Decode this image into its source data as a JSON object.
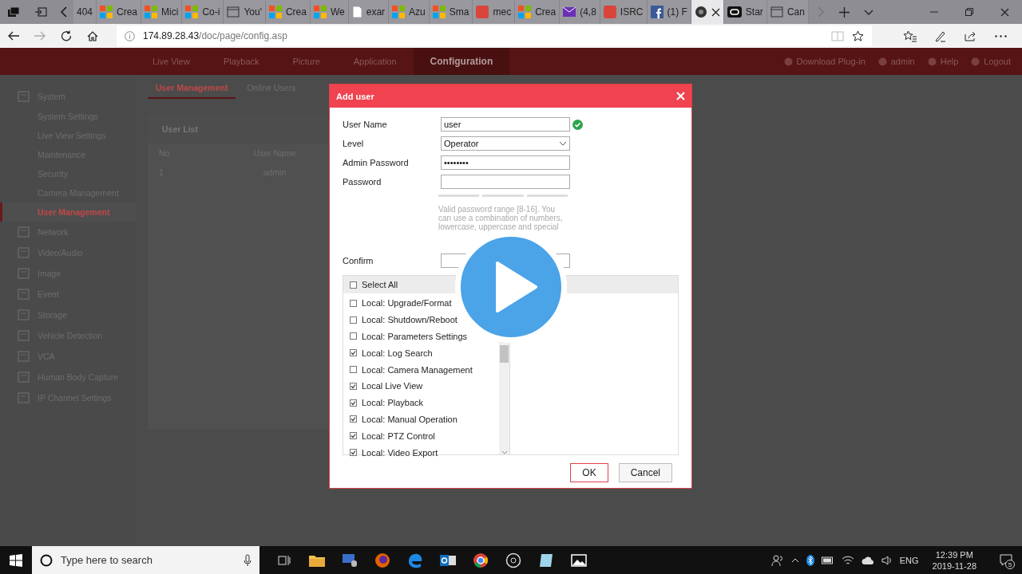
{
  "browser": {
    "tabs": [
      {
        "kind": "none",
        "title": "404",
        "selected": false
      },
      {
        "kind": "tiles",
        "title": "Crea",
        "selected": false
      },
      {
        "kind": "tiles",
        "title": "Mici",
        "selected": false
      },
      {
        "kind": "tiles",
        "title": "Co-i",
        "selected": false
      },
      {
        "kind": "window",
        "title": "You'",
        "selected": false
      },
      {
        "kind": "tiles",
        "title": "Crea",
        "selected": false
      },
      {
        "kind": "tiles",
        "title": "We",
        "selected": false
      },
      {
        "kind": "page",
        "title": "exar",
        "selected": false
      },
      {
        "kind": "tiles",
        "title": "Azu",
        "selected": false
      },
      {
        "kind": "tiles",
        "title": "Sma",
        "selected": false
      },
      {
        "kind": "badge",
        "title": "mec",
        "selected": false
      },
      {
        "kind": "tiles",
        "title": "Crea",
        "selected": false
      },
      {
        "kind": "mail",
        "title": "(4,8",
        "selected": false
      },
      {
        "kind": "badge",
        "title": "ISRC",
        "selected": false
      },
      {
        "kind": "facebook",
        "title": "(1) F",
        "selected": false
      },
      {
        "kind": "camera",
        "selected": true
      },
      {
        "kind": "oval",
        "title": "Star",
        "selected": false
      },
      {
        "kind": "window",
        "title": "Can",
        "selected": false
      }
    ],
    "address_host": "174.89.28.43",
    "address_path": "/doc/page/config.asp"
  },
  "header": {
    "nav": [
      {
        "label": "Live View",
        "selected": false
      },
      {
        "label": "Playback",
        "selected": false
      },
      {
        "label": "Picture",
        "selected": false
      },
      {
        "label": "Application",
        "selected": false
      },
      {
        "label": "Configuration",
        "selected": true
      }
    ],
    "links": [
      "Download Plug-in",
      "admin",
      "Help",
      "Logout"
    ]
  },
  "sidebar": {
    "items": [
      {
        "label": "System",
        "children": [
          {
            "label": "System Settings",
            "selected": false
          },
          {
            "label": "Live View Settings",
            "selected": false
          },
          {
            "label": "Maintenance",
            "selected": false
          },
          {
            "label": "Security",
            "selected": false
          },
          {
            "label": "Camera Management",
            "selected": false
          },
          {
            "label": "User Management",
            "selected": true
          }
        ]
      },
      {
        "label": "Network"
      },
      {
        "label": "Video/Audio"
      },
      {
        "label": "Image"
      },
      {
        "label": "Event"
      },
      {
        "label": "Storage"
      },
      {
        "label": "Vehicle Detection"
      },
      {
        "label": "VCA"
      },
      {
        "label": "Human Body Capture"
      },
      {
        "label": "IP Channel Settings"
      }
    ]
  },
  "content": {
    "tabs": [
      {
        "label": "User Management",
        "selected": true
      },
      {
        "label": "Online Users",
        "selected": false
      }
    ],
    "user_list": {
      "title": "User List",
      "columns": [
        "No",
        "User Name"
      ],
      "rows": [
        [
          "1",
          "admin"
        ]
      ]
    }
  },
  "dialog": {
    "title": "Add user",
    "fields": [
      {
        "kind": "text",
        "label": "User Name",
        "value": "user",
        "valid": true
      },
      {
        "kind": "select",
        "label": "Level",
        "value": "Operator"
      },
      {
        "kind": "password",
        "label": "Admin Password",
        "value": "••••••••"
      },
      {
        "kind": "password",
        "label": "Password"
      }
    ],
    "hint": "Valid password range [8-16]. You can use a combination of numbers, lowercase, uppercase and special",
    "confirm_label": "Confirm",
    "select_all": {
      "label": "Select All",
      "checked": false
    },
    "permissions": [
      {
        "label": "Local: Upgrade/Format",
        "checked": false
      },
      {
        "label": "Local: Shutdown/Reboot",
        "checked": false
      },
      {
        "label": "Local: Parameters Settings",
        "checked": false
      },
      {
        "label": "Local: Log Search",
        "checked": true
      },
      {
        "label": "Local: Camera Management",
        "checked": false
      },
      {
        "label": "Local Live View",
        "checked": true
      },
      {
        "label": "Local: Playback",
        "checked": true
      },
      {
        "label": "Local: Manual Operation",
        "checked": true
      },
      {
        "label": "Local: PTZ Control",
        "checked": true
      },
      {
        "label": "Local: Video Export",
        "checked": true
      }
    ],
    "buttons": [
      {
        "label": "OK",
        "selected": true
      },
      {
        "label": "Cancel",
        "selected": false
      }
    ]
  },
  "taskbar": {
    "search_placeholder": "Type here to search",
    "language": "ENG",
    "time": "12:39 PM",
    "date": "2019-11-28",
    "notifications": "5"
  }
}
